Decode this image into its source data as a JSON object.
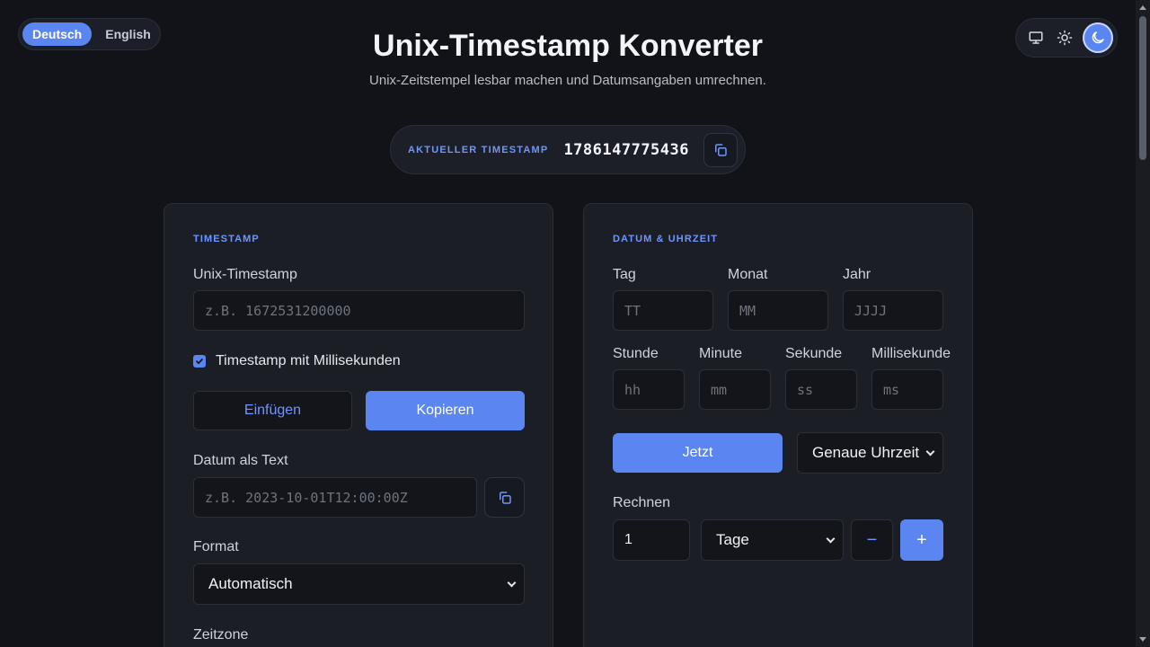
{
  "lang": {
    "options": [
      "Deutsch",
      "English"
    ],
    "selected": "Deutsch"
  },
  "theme": {
    "options": [
      "monitor-icon",
      "sun-icon",
      "moon-icon"
    ],
    "selected": "moon-icon"
  },
  "header": {
    "title": "Unix-Timestamp Konverter",
    "subtitle": "Unix-Zeitstempel lesbar machen und Datumsangaben umrechnen."
  },
  "current": {
    "label": "AKTUELLER TIMESTAMP",
    "value": "1786147775436"
  },
  "timestamp_card": {
    "heading": "TIMESTAMP",
    "unix_label": "Unix-Timestamp",
    "unix_placeholder": "z.B. 1672531200000",
    "ms_checkbox_label": "Timestamp mit Millisekunden",
    "ms_checked": true,
    "paste_label": "Einfügen",
    "copy_label": "Kopieren",
    "text_label": "Datum als Text",
    "text_placeholder": "z.B. 2023-10-01T12:00:00Z",
    "format_label": "Format",
    "format_value": "Automatisch",
    "timezone_label": "Zeitzone"
  },
  "date_card": {
    "heading": "DATUM & UHRZEIT",
    "day_label": "Tag",
    "day_placeholder": "TT",
    "month_label": "Monat",
    "month_placeholder": "MM",
    "year_label": "Jahr",
    "year_placeholder": "JJJJ",
    "hour_label": "Stunde",
    "hour_placeholder": "hh",
    "minute_label": "Minute",
    "minute_placeholder": "mm",
    "second_label": "Sekunde",
    "second_placeholder": "ss",
    "ms_label": "Millisekunde",
    "ms_placeholder": "ms",
    "now_label": "Jetzt",
    "precision_value": "Genaue Uhrzeit",
    "calc_label": "Rechnen",
    "calc_amount": "1",
    "calc_unit": "Tage",
    "minus_label": "−",
    "plus_label": "+"
  },
  "colors": {
    "accent": "#5b86f2",
    "accent_text": "#6f96ff",
    "background": "#111318",
    "card": "#1b1e25"
  }
}
